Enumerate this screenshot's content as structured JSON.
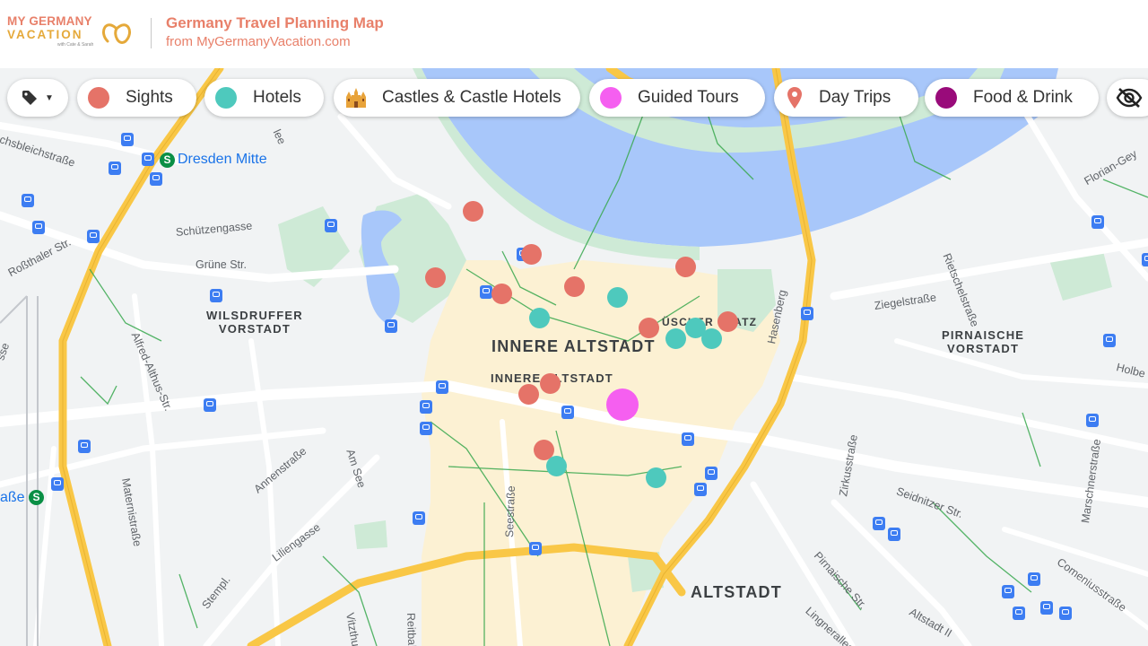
{
  "header": {
    "logo": {
      "line1": "MY GERMANY",
      "line2": "VACATION",
      "line3": "with Cate & Sarah"
    },
    "title": "Germany Travel Planning Map",
    "subtitle": "from MyGermanyVacation.com"
  },
  "filters": {
    "tags_icon": "tag-icon",
    "items": [
      {
        "label": "Sights",
        "color": "#e57368",
        "icon": "dot"
      },
      {
        "label": "Hotels",
        "color": "#4ec9bd",
        "icon": "dot"
      },
      {
        "label": "Castles & Castle Hotels",
        "color": "#e8a33a",
        "icon": "castle-icon"
      },
      {
        "label": "Guided Tours",
        "color": "#f55ff0",
        "icon": "dot"
      },
      {
        "label": "Day Trips",
        "color": "#e57368",
        "icon": "map-pin-icon"
      },
      {
        "label": "Food & Drink",
        "color": "#990b7a",
        "icon": "dot"
      }
    ],
    "visibility_icon": "eye-off-icon"
  },
  "map": {
    "districts": {
      "innere_altstadt": "INNERE ALTSTADT",
      "innere_altstadt_small": "INNERE ALTSTADT",
      "wilsdruffer": "WILSDRUFFER\nVORSTADT",
      "pirnaische": "PIRNAISCHE\nVORSTADT",
      "altstadt": "ALTSTADT",
      "neumarkt_partial": "ÜSCHER PLATZ"
    },
    "places": {
      "dresden_mitte": "Dresden Mitte"
    },
    "streets": {
      "schuetzengasse": "Schützengasse",
      "gruene": "Grüne Str.",
      "rosthaler": "Roßthaler Str.",
      "alfred": "Alfred-Althus-Str.",
      "maternistrasse": "Maternistraße",
      "annenstrasse": "Annenstraße",
      "am_see": "Am See",
      "liliengasse": "Liliengasse",
      "stempel": "Stempl.",
      "seestrasse": "Seestraße",
      "reitbahn": "Reitbahns",
      "vitzthum": "Vitzthumst",
      "hasenberg": "Hasenberg",
      "ziegelstrasse": "Ziegelstraße",
      "rietschelstrasse": "Rietschelstraße",
      "florian": "Florian-Gey",
      "holbe": "Holbe",
      "zirkusstrasse": "Zirkusstraße",
      "seidnitzer": "Seidnitzer Str.",
      "marschner": "Marschnerstraße",
      "comenius": "Comeniusstraße",
      "pirnaische_str": "Pirnaische Str.",
      "lingner": "Lingnerallee",
      "altstadt2": "Altstadt II",
      "bleichstrasse": "chsbleichstraße",
      "asse": "aße",
      "lee": "lee",
      "sse": "sse"
    },
    "marker_colors": {
      "sight": "#e57368",
      "hotel": "#4ec9bd",
      "tour": "#f55ff0"
    }
  }
}
